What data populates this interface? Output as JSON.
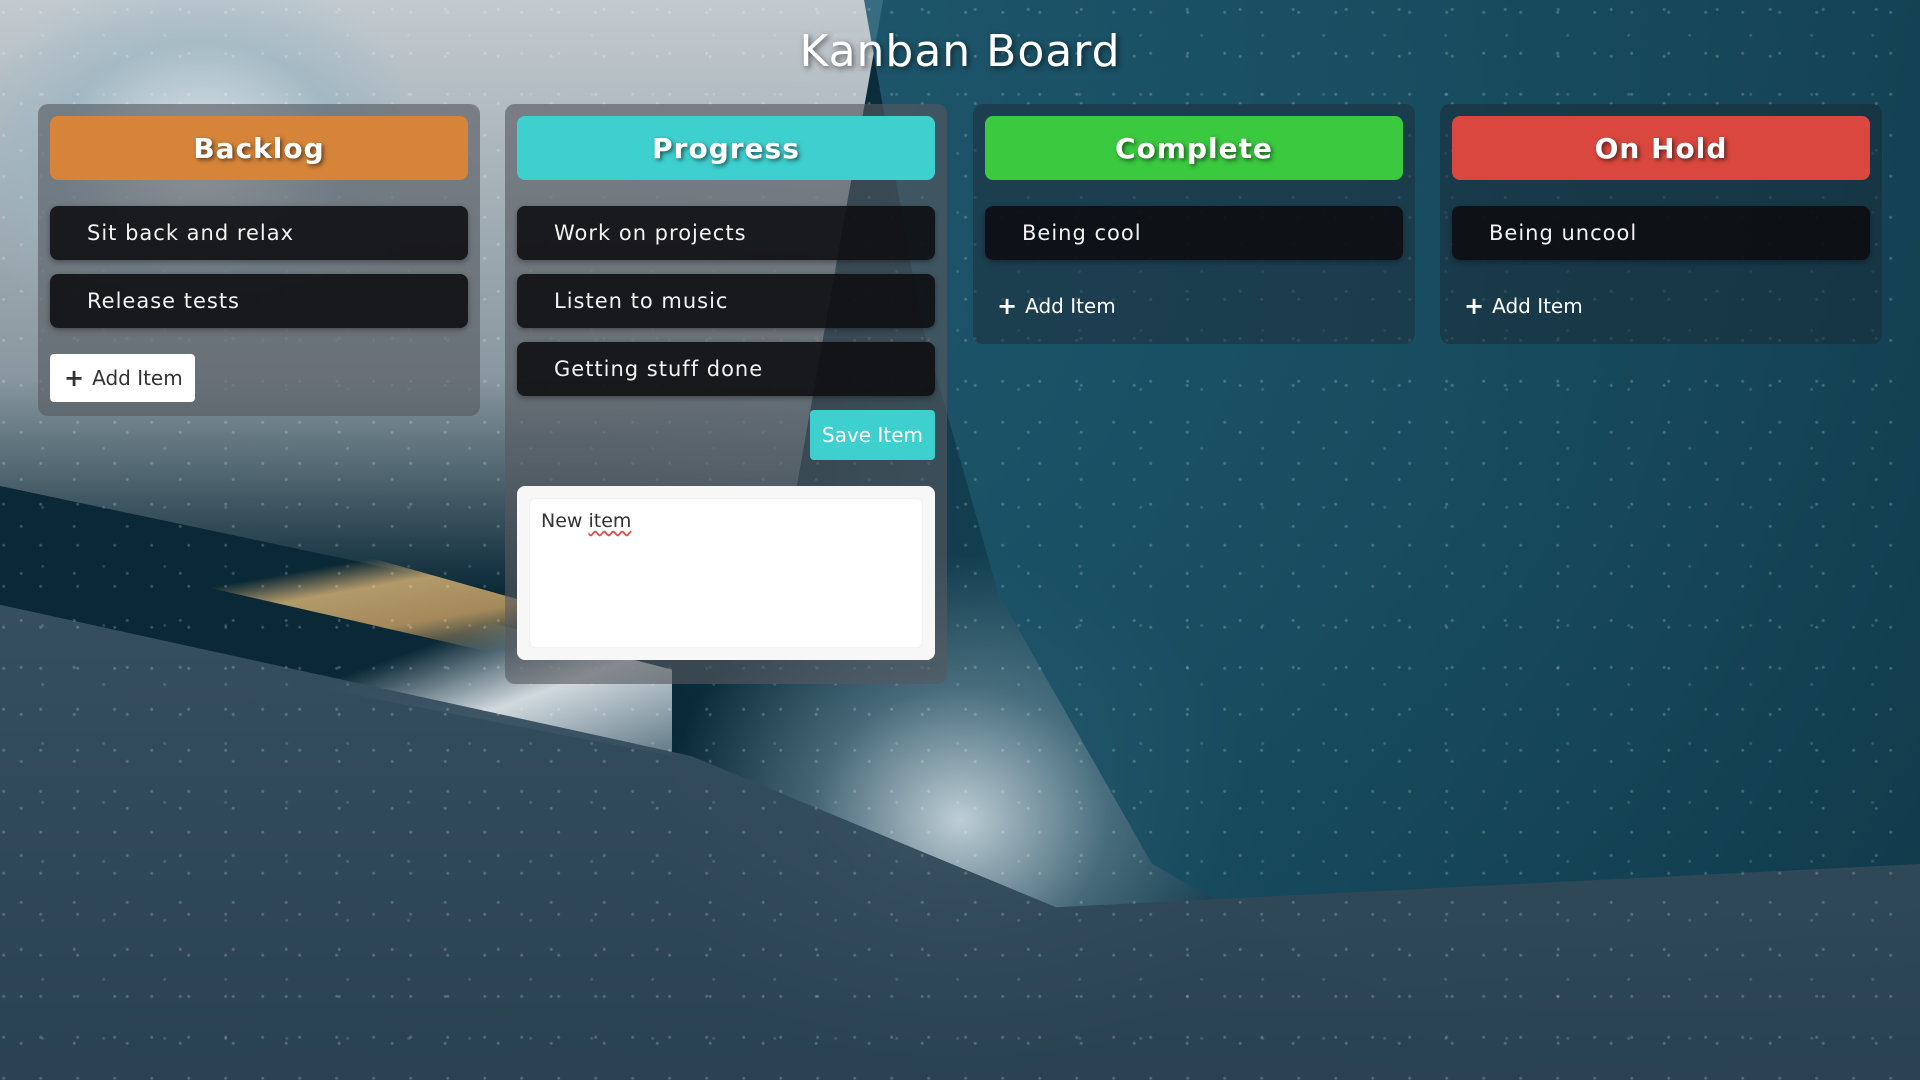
{
  "page": {
    "title": "Kanban Board"
  },
  "colors": {
    "backlog": "#d6843a",
    "progress": "#3ecfcf",
    "complete": "#3ac93f",
    "on_hold": "#d9473e"
  },
  "columns": {
    "backlog": {
      "title": "Backlog",
      "items": [
        "Sit back and relax",
        "Release tests"
      ],
      "add_label": "Add Item"
    },
    "progress": {
      "title": "Progress",
      "items": [
        "Work on projects",
        "Listen to music",
        "Getting stuff done"
      ],
      "save_label": "Save Item",
      "new_item_text_1": "New ",
      "new_item_text_2": "item"
    },
    "complete": {
      "title": "Complete",
      "items": [
        "Being cool"
      ],
      "add_label": "Add Item"
    },
    "on_hold": {
      "title": "On Hold",
      "items": [
        "Being uncool"
      ],
      "add_label": "Add Item"
    }
  },
  "icons": {
    "add": "plus-icon"
  }
}
